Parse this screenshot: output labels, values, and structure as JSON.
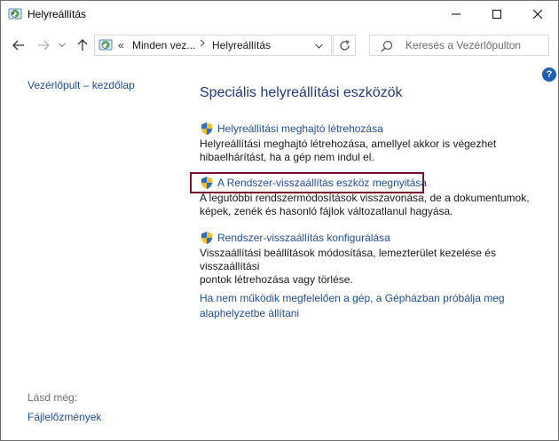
{
  "window": {
    "title": "Helyreállítás",
    "app_icon": "recovery-icon"
  },
  "address": {
    "overflow": "«",
    "crumbs": [
      "Minden vez...",
      "Helyreállítás"
    ]
  },
  "search": {
    "placeholder": "Keresés a Vezérlőpulton"
  },
  "help": {
    "label": "?"
  },
  "sidebar": {
    "home_link": "Vezérlőpult – kezdőlap",
    "see_also": "Lásd még:",
    "file_history": "Fájlelőzmények"
  },
  "main": {
    "heading": "Speciális helyreállítási eszközök",
    "tasks": [
      {
        "label": "Helyreállítási meghajtó létrehozása",
        "desc": [
          "Helyreállítási meghajtó létrehozása, amellyel akkor is végezhet",
          "hibaelhárítást, ha a gép nem indul el."
        ]
      },
      {
        "label": "A Rendszer-visszaállítás eszköz megnyitása",
        "desc": [
          "A legutóbbi rendszermódosítások visszavonása, de a dokumentumok,",
          "képek, zenék és hasonló fájlok változatlanul hagyása."
        ]
      },
      {
        "label": "Rendszer-visszaállítás konfigurálása",
        "desc": [
          "Visszaállítási beállítások módosítása, lemezterület kezelése és visszaállítási",
          "pontok létrehozása vagy törlése."
        ]
      }
    ],
    "bottom_link": "Ha nem működik megfelelően a gép, a Gépházban próbálja meg alaphelyzetbe állítani"
  },
  "colors": {
    "link": "#1f4e9e",
    "heading": "#1e3a8a",
    "highlight_border": "#7a1030",
    "help_bg": "#1f5fb4"
  }
}
